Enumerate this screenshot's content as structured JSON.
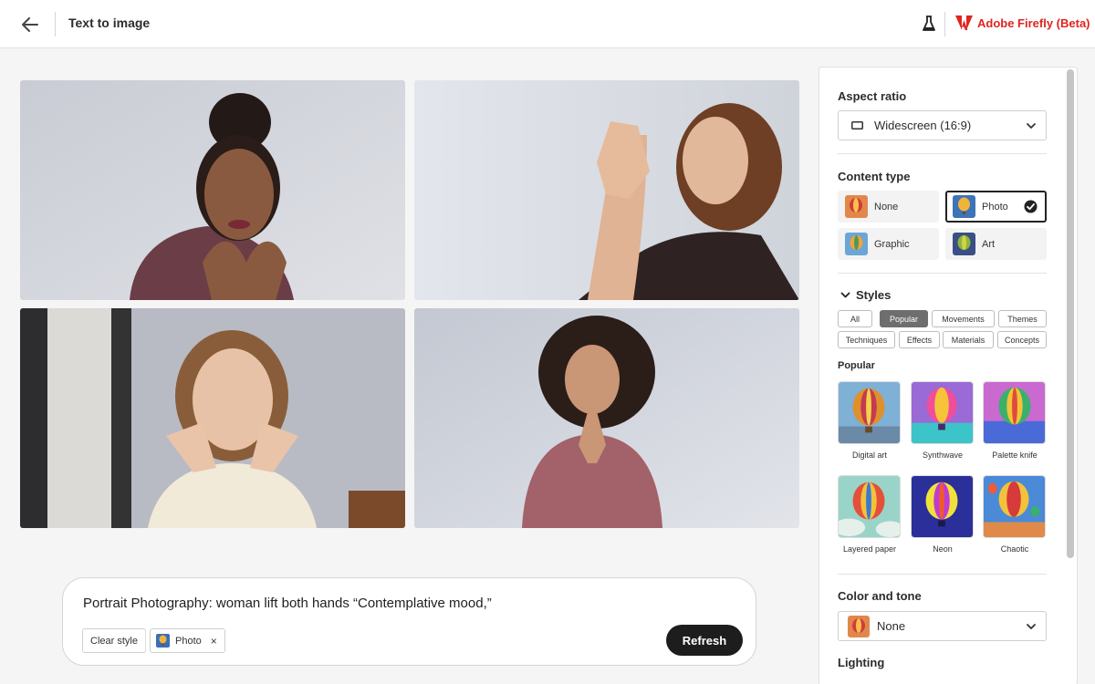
{
  "header": {
    "title": "Text to image",
    "brand": "Adobe Firefly (Beta)",
    "back_icon": "arrow-left-icon",
    "labs_icon": "flask-icon",
    "brand_color": "#e0241f"
  },
  "images": [
    {
      "name": "generated-image-1"
    },
    {
      "name": "generated-image-2"
    },
    {
      "name": "generated-image-3"
    },
    {
      "name": "generated-image-4"
    }
  ],
  "prompt": {
    "text": "Portrait Photography: woman lift both hands “Contemplative mood,”",
    "clear_style": "Clear style",
    "tag_label": "Photo",
    "tag_close": "×",
    "refresh": "Refresh"
  },
  "panel": {
    "aspect_ratio": {
      "label": "Aspect ratio",
      "value": "Widescreen (16:9)"
    },
    "content_type": {
      "label": "Content type",
      "options": [
        "None",
        "Photo",
        "Graphic",
        "Art"
      ],
      "selected": "Photo"
    },
    "styles": {
      "label": "Styles",
      "chips_row1": [
        "All",
        "Popular",
        "Movements",
        "Themes"
      ],
      "chips_row2": [
        "Techniques",
        "Effects",
        "Materials",
        "Concepts"
      ],
      "active_chip": "Popular",
      "section": "Popular",
      "items": [
        "Digital art",
        "Synthwave",
        "Palette knife",
        "Layered paper",
        "Neon",
        "Chaotic"
      ]
    },
    "color_tone": {
      "label": "Color and tone",
      "value": "None"
    },
    "lighting": {
      "label": "Lighting"
    }
  }
}
